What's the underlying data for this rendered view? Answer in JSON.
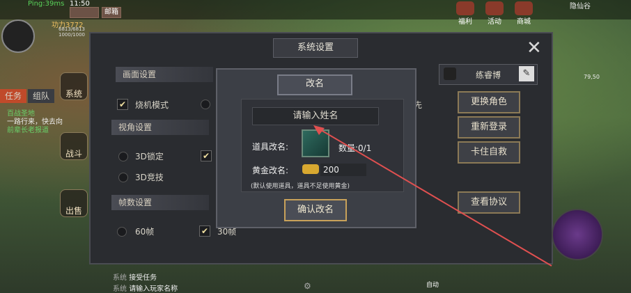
{
  "status_bar": {
    "ping": "Ping:39ms",
    "time": "11:50",
    "btn_a": "",
    "btn_b": "",
    "btn_c": "邮箱",
    "btn_d": "10"
  },
  "player": {
    "power": "功力3772",
    "hp": "6813/6813",
    "mp": "1000/1000"
  },
  "top_icons": [
    {
      "label": "福利"
    },
    {
      "label": "活动"
    },
    {
      "label": "商城"
    }
  ],
  "map": {
    "name": "隐仙谷",
    "coords": "79,50"
  },
  "left_panel": {
    "tabs": [
      "任务",
      "组队"
    ],
    "buttons": [
      "系统",
      "战斗",
      "出售"
    ],
    "quest_lines": [
      "百战圣地",
      "一路行来，快去向",
      "前辈长老报道"
    ]
  },
  "settings": {
    "title": "系统设置",
    "sections": {
      "display": {
        "title": "画面设置",
        "options": [
          {
            "label": "烧机模式",
            "checked": true
          },
          {
            "label": "",
            "checked": false
          }
        ]
      },
      "view": {
        "title": "视角设置",
        "options": [
          {
            "label": "3D锁定",
            "checked": false
          },
          {
            "label": "3D竞技",
            "checked": false
          }
        ]
      },
      "fps": {
        "title": "帧数设置",
        "options": [
          {
            "label": "60帧",
            "checked": false
          },
          {
            "label": "30帧",
            "checked": true
          }
        ]
      }
    },
    "side_fragment": "先",
    "player_name": "练睿博",
    "right_buttons": [
      "更换角色",
      "重新登录",
      "卡住自救",
      "查看协议"
    ]
  },
  "rename_dialog": {
    "title": "改名",
    "name_placeholder": "请输入姓名",
    "item_label": "道具改名:",
    "item_qty": "数量:0/1",
    "gold_label": "黄金改名:",
    "gold_value": "200",
    "note": "(默认使用道具，道具不足使用黄金)",
    "confirm_label": "确认改名"
  },
  "chat": [
    {
      "tag": "系统",
      "text": "接受任务"
    },
    {
      "tag": "系统",
      "text": "请输入玩家名称"
    }
  ],
  "bottom": {
    "auto_label": "自动"
  },
  "colors": {
    "accent_gold": "#c9a25a",
    "panel_bg": "#2a2c30",
    "annotation_arrow": "#e05050"
  }
}
